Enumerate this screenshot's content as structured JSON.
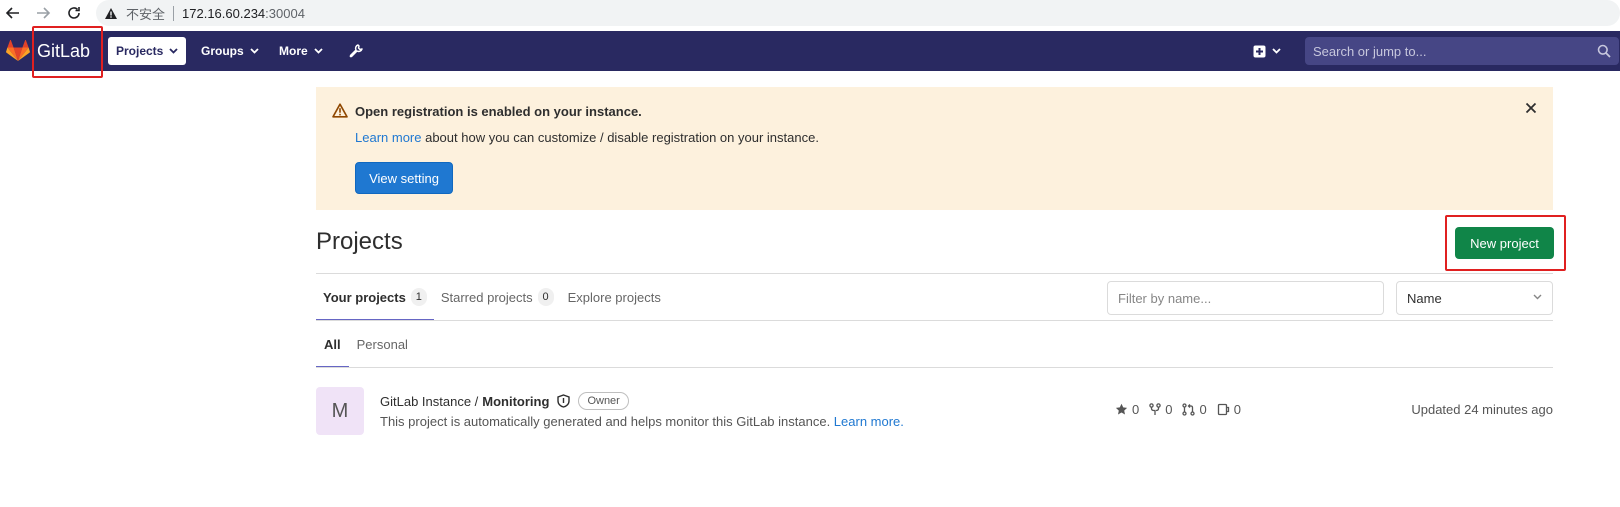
{
  "browser": {
    "insecure_label": "不安全",
    "host": "172.16.60.234",
    "port": ":30004"
  },
  "header": {
    "brand": "GitLab",
    "nav": [
      {
        "label": "Projects"
      },
      {
        "label": "Groups"
      },
      {
        "label": "More"
      }
    ],
    "search_placeholder": "Search or jump to..."
  },
  "alert": {
    "title": "Open registration is enabled on your instance.",
    "link_text": "Learn more",
    "body_rest": " about how you can customize / disable registration on your instance.",
    "button": "View setting"
  },
  "page": {
    "title": "Projects",
    "new_button": "New project"
  },
  "tabs": [
    {
      "label": "Your projects",
      "count": "1"
    },
    {
      "label": "Starred projects",
      "count": "0"
    },
    {
      "label": "Explore projects"
    }
  ],
  "filter_placeholder": "Filter by name...",
  "sort_selected": "Name",
  "subtabs": [
    {
      "label": "All"
    },
    {
      "label": "Personal"
    }
  ],
  "project": {
    "avatar_letter": "M",
    "namespace": "GitLab Instance /",
    "name": "Monitoring",
    "role": "Owner",
    "description": "This project is automatically generated and helps monitor this GitLab instance. ",
    "desc_link": "Learn more.",
    "stars": "0",
    "forks": "0",
    "merge_requests": "0",
    "issues": "0",
    "updated": "Updated 24 minutes ago"
  },
  "colors": {
    "header_bg": "#292961",
    "alert_bg": "#fdf1dd",
    "primary_blue": "#1f78d1",
    "success_green": "#108548",
    "annotation_red": "#e02020"
  }
}
